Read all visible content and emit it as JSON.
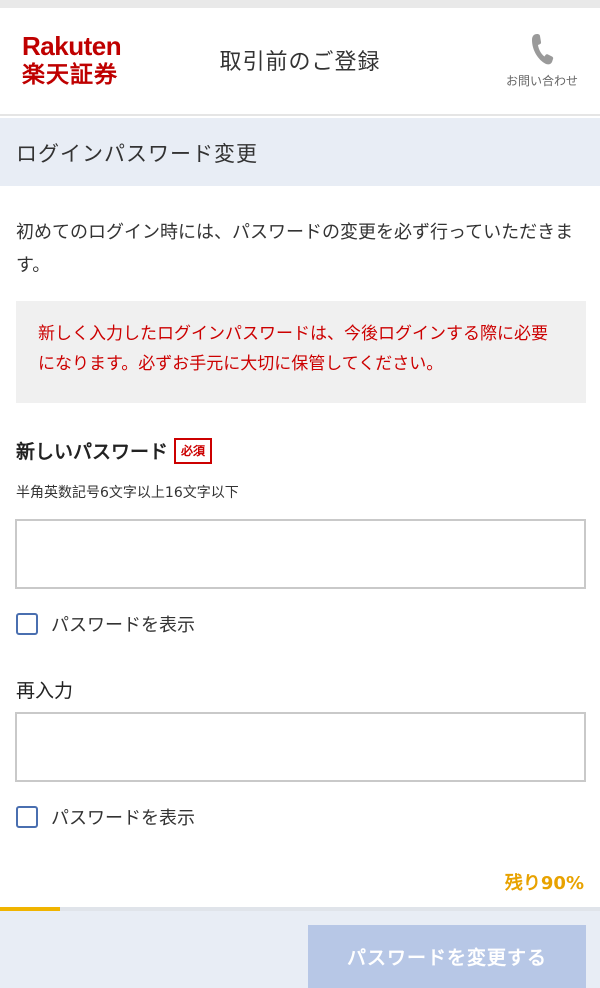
{
  "header": {
    "logo_en": "Rakuten",
    "logo_ja": "楽天証券",
    "title": "取引前のご登録",
    "contact_label": "お問い合わせ",
    "contact_icon": "phone-icon"
  },
  "section": {
    "title": "ログインパスワード変更"
  },
  "intro_text": "初めてのログイン時には、パスワードの変更を必ず行っていただきます。",
  "notice_text": "新しく入力したログインパスワードは、今後ログインする際に必要になります。必ずお手元に大切に保管してください。",
  "new_password": {
    "label": "新しいパスワード",
    "required_badge": "必須",
    "hint": "半角英数記号6文字以上16文字以下",
    "value": "",
    "placeholder": "",
    "show_label": "パスワードを表示",
    "show_checked": false
  },
  "reenter": {
    "label": "再入力",
    "value": "",
    "placeholder": "",
    "show_label": "パスワードを表示",
    "show_checked": false
  },
  "progress": {
    "remaining_text": "残り90%",
    "completed_fraction": 0.1
  },
  "submit_label": "パスワードを変更する",
  "colors": {
    "brand": "#bf0000",
    "notice": "#cc0000",
    "accent_progress": "#f0b400",
    "remaining": "#e8a200",
    "section_bg": "#e8edf5",
    "submit_disabled": "#b7c7e6",
    "checkbox_border": "#4a6fb0"
  }
}
